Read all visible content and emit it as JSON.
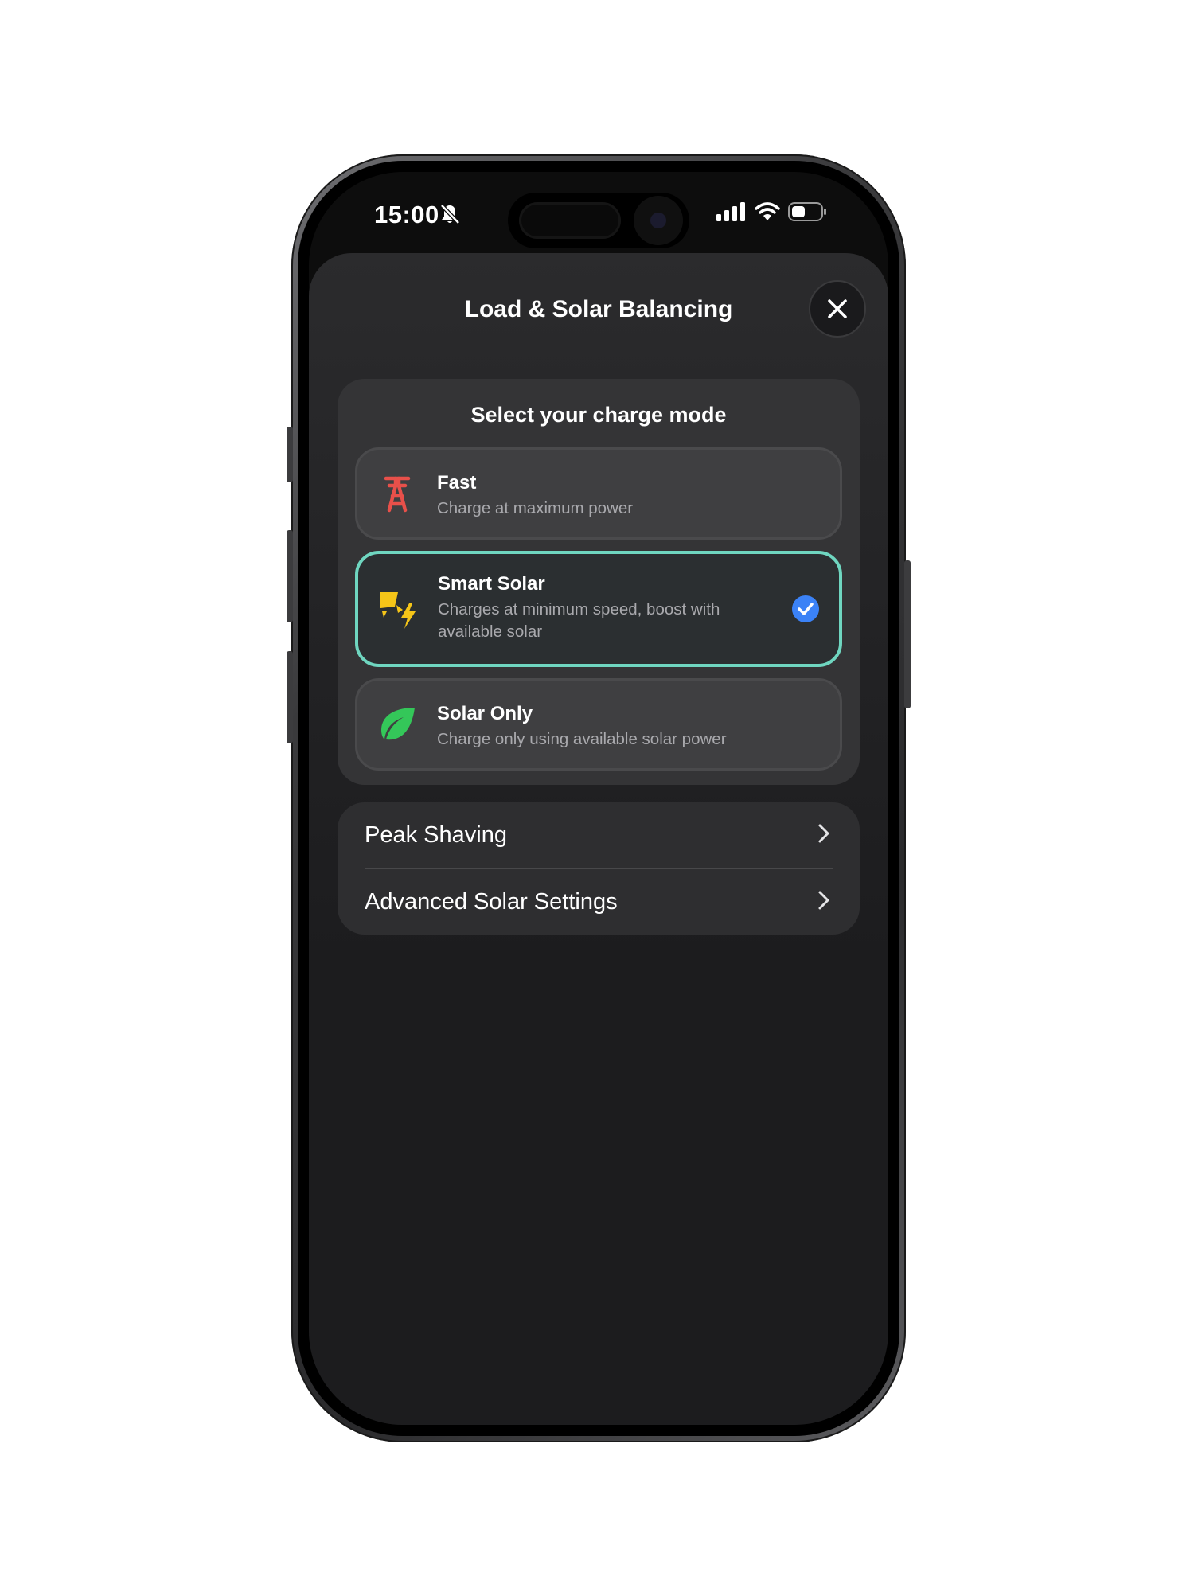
{
  "status_bar": {
    "time": "15:00",
    "mute_icon": "bell-slash-icon",
    "signal_icon": "cellular-signal-icon",
    "wifi_icon": "wifi-icon",
    "battery_icon": "battery-icon"
  },
  "sheet": {
    "title": "Load & Solar Balancing",
    "close_icon": "close-icon"
  },
  "charge_mode": {
    "heading": "Select your charge mode",
    "options": [
      {
        "title": "Fast",
        "description": "Charge at maximum power",
        "icon": "power-tower-icon",
        "icon_color": "#e8504a",
        "selected": false
      },
      {
        "title": "Smart Solar",
        "description": "Charges at minimum speed, boost with available solar",
        "icon": "solar-bolt-icon",
        "icon_color": "#f5c518",
        "selected": true
      },
      {
        "title": "Solar Only",
        "description": "Charge only using available solar power",
        "icon": "leaf-icon",
        "icon_color": "#34c759",
        "selected": false
      }
    ],
    "selected_color": "#6fd6c0",
    "check_color": "#3b82f6"
  },
  "settings": {
    "items": [
      {
        "label": "Peak Shaving",
        "icon": "chevron-right-icon"
      },
      {
        "label": "Advanced Solar Settings",
        "icon": "chevron-right-icon"
      }
    ]
  }
}
